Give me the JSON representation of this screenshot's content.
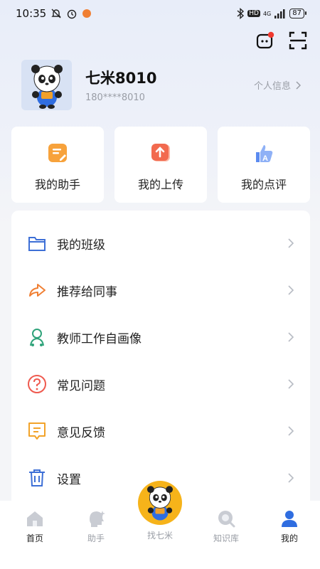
{
  "status_bar": {
    "time": "10:35",
    "network": "HD",
    "signal": "4G",
    "battery": "87"
  },
  "profile": {
    "name": "七米8010",
    "phone": "180****8010",
    "info_link": "个人信息"
  },
  "quick_cards": [
    {
      "label": "我的助手",
      "icon": "assistant-note-icon",
      "color": "#f7a23b"
    },
    {
      "label": "我的上传",
      "icon": "upload-icon",
      "color": "#f26a4f"
    },
    {
      "label": "我的点评",
      "icon": "thumbs-up-icon",
      "color": "#5b8bf0"
    }
  ],
  "menu": [
    {
      "label": "我的班级",
      "icon": "folder-icon",
      "color": "#3d6fd6"
    },
    {
      "label": "推荐给同事",
      "icon": "share-arrow-icon",
      "color": "#f07f33"
    },
    {
      "label": "教师工作自画像",
      "icon": "person-portrait-icon",
      "color": "#2fa37a"
    },
    {
      "label": "常见问题",
      "icon": "question-icon",
      "color": "#ef5a4f"
    },
    {
      "label": "意见反馈",
      "icon": "feedback-icon",
      "color": "#f2a32a"
    },
    {
      "label": "设置",
      "icon": "trash-settings-icon",
      "color": "#3d6fd6"
    }
  ],
  "tabbar": {
    "home": "首页",
    "assistant": "助手",
    "find": "找七米",
    "knowledge": "知识库",
    "mine": "我的",
    "active_color": "#2f6de0",
    "inactive_color": "#c9ccd3",
    "center_color": "#f6b31a"
  }
}
